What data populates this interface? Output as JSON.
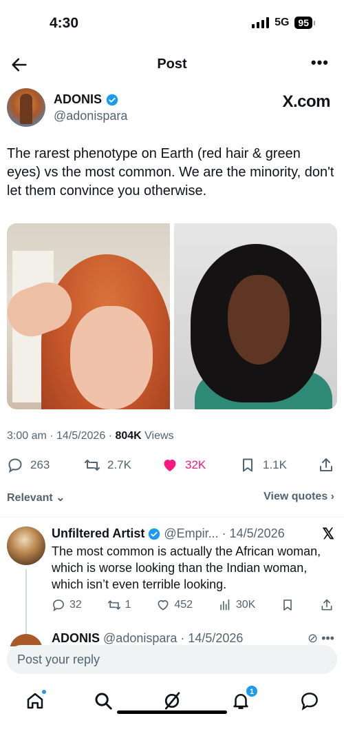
{
  "status_bar": {
    "time": "4:30",
    "network": "5G",
    "battery": "95"
  },
  "nav": {
    "title": "Post"
  },
  "post": {
    "author_name": "ADONIS",
    "author_handle": "@adonispara",
    "brand": "X.com",
    "text": "The rarest phenotype on Earth (red hair & green eyes) vs the most common. We are the minority, don't let them convince you otherwise.",
    "timestamp": "3:00 am · 14/5/2026 · ",
    "views_count": "804K",
    "views_label": " Views",
    "replies": "263",
    "reposts": "2.7K",
    "likes": "32K",
    "bookmarks": "1.1K"
  },
  "sort": {
    "label": "Relevant",
    "view_quotes": "View quotes"
  },
  "reply": {
    "name": "Unfiltered Artist",
    "handle_date": "@Empir... · 14/5/2026",
    "text": "The most common is actually the African woman, which is worse looking than the Indian woman, which isn’t even terrible looking.",
    "replies": "32",
    "reposts": "1",
    "likes": "452",
    "views": "30K"
  },
  "reply2": {
    "name": "ADONIS",
    "handle_date": "@adonispara · 14/5/2026"
  },
  "compose": {
    "placeholder": "Post your reply"
  },
  "tabbar": {
    "notifications_badge": "1"
  },
  "colors": {
    "like": "#f91880",
    "verified": "#1d9bf0",
    "accent": "#1d9bf0"
  }
}
